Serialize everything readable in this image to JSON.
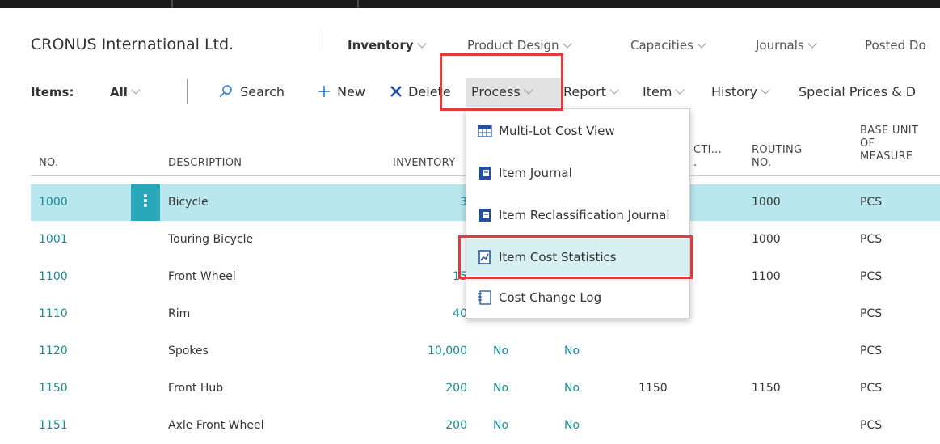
{
  "nav": {
    "company": "CRONUS International Ltd.",
    "items": [
      {
        "label": "Inventory",
        "bold": true
      },
      {
        "label": "Product Design"
      },
      {
        "label": "Capacities"
      },
      {
        "label": "Journals"
      },
      {
        "label": "Posted Do"
      }
    ]
  },
  "actionbar": {
    "items_label": "Items:",
    "filter": "All",
    "search": "Search",
    "new": "New",
    "delete": "Delete",
    "process": "Process",
    "report": "Report",
    "item": "Item",
    "history": "History",
    "special_prices": "Special Prices & D"
  },
  "table": {
    "headers": {
      "no": "NO.",
      "description": "DESCRIPTION",
      "inventory": "INVENTORY",
      "production_bom_1": "CTI...",
      "production_bom_2": ".",
      "routing_1": "ROUTING",
      "routing_2": "NO.",
      "base_uom_1": "BASE UNIT",
      "base_uom_2": "OF",
      "base_uom_3": "MEASURE"
    },
    "rows": [
      {
        "no": "1000",
        "description": "Bicycle",
        "inventory": "3",
        "substitutes": "",
        "stockkeeping": "",
        "bom": "",
        "routing": "1000",
        "uom": "PCS"
      },
      {
        "no": "1001",
        "description": "Touring Bicycle",
        "inventory": "",
        "substitutes": "",
        "stockkeeping": "",
        "bom": "",
        "routing": "1000",
        "uom": "PCS"
      },
      {
        "no": "1100",
        "description": "Front Wheel",
        "inventory": "15",
        "substitutes": "",
        "stockkeeping": "",
        "bom": "",
        "routing": "1100",
        "uom": "PCS"
      },
      {
        "no": "1110",
        "description": "Rim",
        "inventory": "40",
        "substitutes": "",
        "stockkeeping": "",
        "bom": "",
        "routing": "",
        "uom": "PCS"
      },
      {
        "no": "1120",
        "description": "Spokes",
        "inventory": "10,000",
        "substitutes": "No",
        "stockkeeping": "No",
        "bom": "",
        "routing": "",
        "uom": "PCS"
      },
      {
        "no": "1150",
        "description": "Front Hub",
        "inventory": "200",
        "substitutes": "No",
        "stockkeeping": "No",
        "bom": "1150",
        "routing": "1150",
        "uom": "PCS"
      },
      {
        "no": "1151",
        "description": "Axle Front Wheel",
        "inventory": "200",
        "substitutes": "No",
        "stockkeeping": "No",
        "bom": "",
        "routing": "",
        "uom": "PCS"
      }
    ]
  },
  "process_menu": {
    "items": [
      {
        "label": "Multi-Lot Cost View",
        "icon": "grid-table-icon"
      },
      {
        "label": "Item Journal",
        "icon": "journal-icon"
      },
      {
        "label": "Item Reclassification Journal",
        "icon": "journal-icon"
      },
      {
        "label": "Item Cost Statistics",
        "icon": "chart-document-icon"
      },
      {
        "label": "Cost Change Log",
        "icon": "log-document-icon"
      }
    ]
  },
  "colors": {
    "accent": "#1a8a94",
    "selected_row": "#b8e8ee",
    "highlight_box": "#e03c3c"
  }
}
